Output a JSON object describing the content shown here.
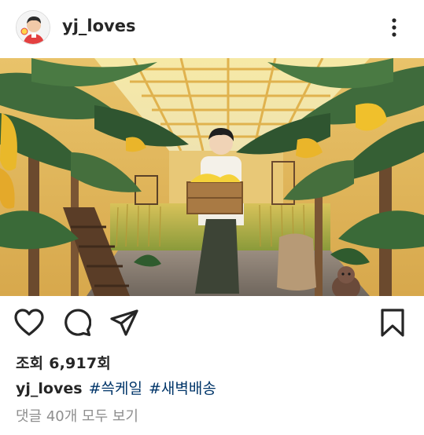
{
  "post": {
    "username": "yj_loves",
    "views_label": "조회",
    "views_count": "6,917",
    "views_suffix": "회",
    "caption_user": "yj_loves",
    "hashtags": [
      "#쓱케일",
      "#새벽배송"
    ],
    "comments_link": "댓글 40개 모두 보기"
  },
  "icons": {
    "avatar": "profile-avatar",
    "more": "more-vertical-icon",
    "like": "heart-icon",
    "comment": "comment-icon",
    "share": "paper-plane-icon",
    "save": "bookmark-icon"
  },
  "colors": {
    "text": "#262626",
    "hashtag": "#003569",
    "muted": "#8e8e8e"
  }
}
